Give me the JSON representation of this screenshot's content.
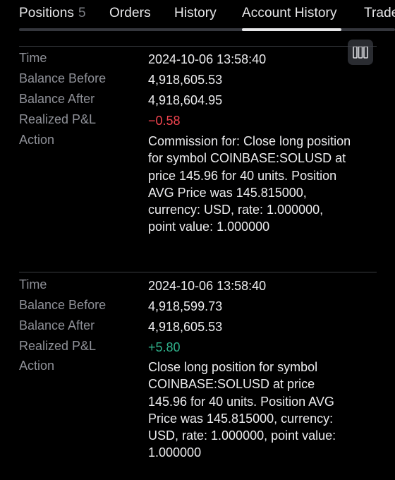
{
  "tabs": [
    {
      "label": "Positions",
      "count": "5"
    },
    {
      "label": "Orders"
    },
    {
      "label": "History"
    },
    {
      "label": "Account History",
      "active": true
    },
    {
      "label": "Trades"
    }
  ],
  "labels": {
    "time": "Time",
    "balance_before": "Balance Before",
    "balance_after": "Balance After",
    "realized_pnl": "Realized P&L",
    "action": "Action"
  },
  "entries": [
    {
      "time": "2024-10-06 13:58:40",
      "balance_before": "4,918,605.53",
      "balance_after": "4,918,604.95",
      "realized_pnl": "−0.58",
      "pnl_sign": "negative",
      "action": "Commission for: Close long position for symbol COINBASE:SOLUSD at price 145.96 for 40 units. Position AVG Price was 145.815000, currency: USD, rate: 1.000000, point value: 1.000000"
    },
    {
      "time": "2024-10-06 13:58:40",
      "balance_before": "4,918,599.73",
      "balance_after": "4,918,605.53",
      "realized_pnl": "+5.80",
      "pnl_sign": "positive",
      "action": "Close long position for symbol COINBASE:SOLUSD at price 145.96 for 40 units. Position AVG Price was 145.815000, currency: USD, rate: 1.000000, point value: 1.000000"
    }
  ],
  "colors": {
    "background": "#000000",
    "negative": "#f2444f",
    "positive": "#2fb08a"
  },
  "icons": {
    "column_settings": "columns-icon"
  }
}
